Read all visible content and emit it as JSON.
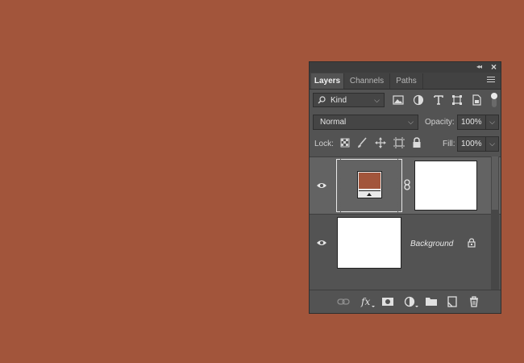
{
  "panel": {
    "tabs": [
      {
        "label": "Layers",
        "active": true
      },
      {
        "label": "Channels",
        "active": false
      },
      {
        "label": "Paths",
        "active": false
      }
    ],
    "filter": {
      "value": "Kind"
    },
    "blend_mode": {
      "value": "Normal"
    },
    "opacity": {
      "label": "Opacity:",
      "value": "100%"
    },
    "lock": {
      "label": "Lock:"
    },
    "fill": {
      "label": "Fill:",
      "value": "100%"
    },
    "layers": [
      {
        "name": "",
        "type": "adjustment",
        "visible": true,
        "selected": true
      },
      {
        "name": "Background",
        "type": "pixel",
        "visible": true,
        "locked": true,
        "selected": false
      }
    ]
  },
  "colors": {
    "canvas_background": "#a2553b",
    "panel_background": "#535353",
    "swatch": "#a2553b"
  }
}
